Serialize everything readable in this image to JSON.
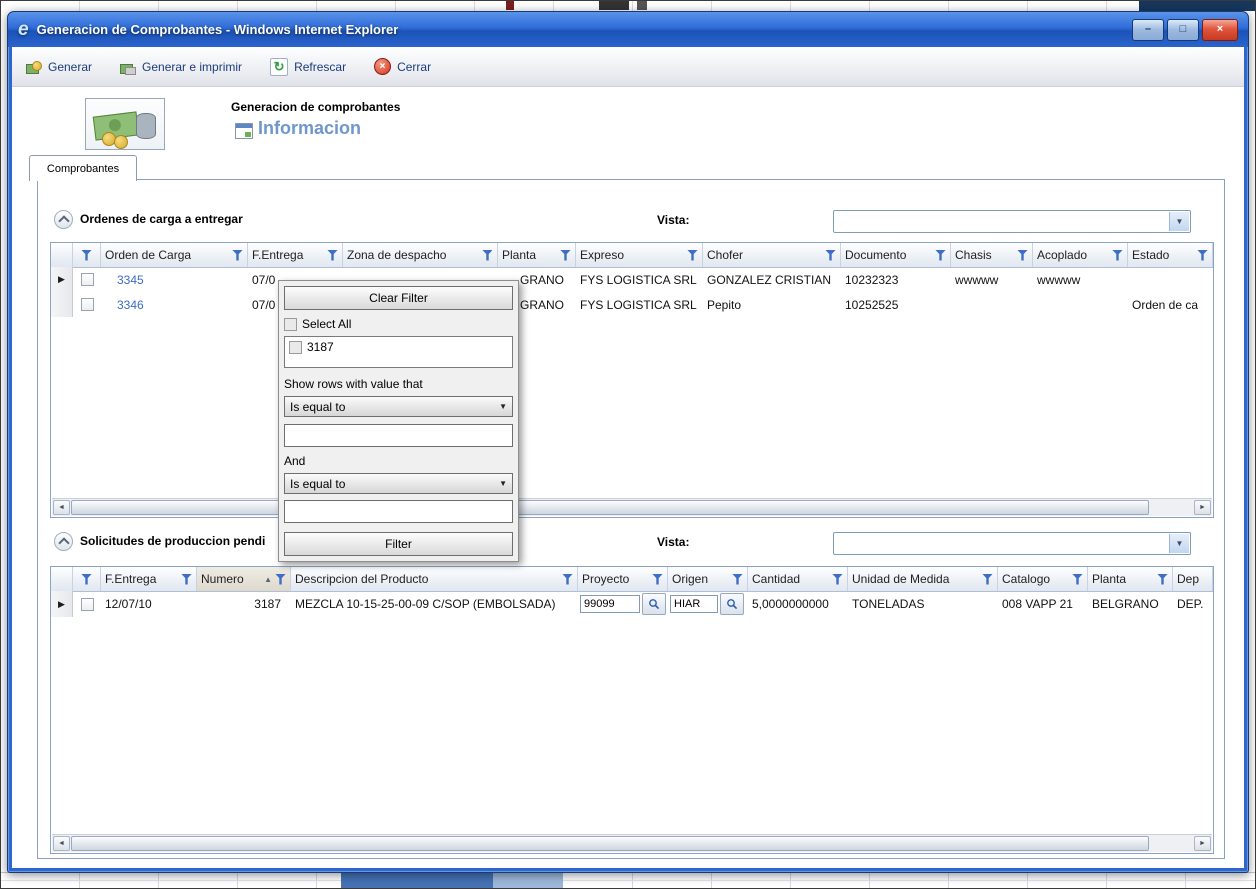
{
  "window": {
    "title": "Generacion de Comprobantes - Windows Internet Explorer"
  },
  "icons": {
    "ie_logo": "e",
    "minimize": "–",
    "maximize": "□",
    "close": "×",
    "refresh": "↻",
    "row_marker": "▶",
    "sort_asc": "▲",
    "dropdown_arrow": "▼",
    "scroll_left": "◄",
    "scroll_right": "►"
  },
  "colors": {
    "titlebar_blue": "#2e68cf",
    "funnel_blue": "#3f6fc4",
    "link_blue": "#3c6cc3",
    "subtitle_blue": "#6f96ce",
    "close_red": "#d6351c"
  },
  "toolbar": {
    "generar": "Generar",
    "generar_imprimir": "Generar e imprimir",
    "refrescar": "Refrescar",
    "cerrar": "Cerrar"
  },
  "page_header": {
    "title": "Generacion de comprobantes",
    "subtitle": "Informacion"
  },
  "tabs": {
    "comprobantes": "Comprobantes"
  },
  "ordenes": {
    "title": "Ordenes de carga a entregar",
    "vista_label": "Vista:",
    "vista_value": "",
    "columns": [
      "Orden de Carga",
      "F.Entrega",
      "Zona de despacho",
      "Planta",
      "Expreso",
      "Chofer",
      "Documento",
      "Chasis",
      "Acoplado",
      "Estado"
    ],
    "rows": [
      {
        "orden_de_carga": "3345",
        "f_entrega": "07/0",
        "zona_de_despacho": "",
        "planta": "GRANO",
        "expreso": "FYS LOGISTICA SRL",
        "chofer": "GONZALEZ CRISTIAN",
        "documento": "10232323",
        "chasis": "wwwww",
        "acoplado": "wwwww",
        "estado": ""
      },
      {
        "orden_de_carga": "3346",
        "f_entrega": "07/0",
        "zona_de_despacho": "",
        "planta": "GRANO",
        "expreso": "FYS LOGISTICA SRL",
        "chofer": "Pepito",
        "documento": "10252525",
        "chasis": "",
        "acoplado": "",
        "estado": "Orden de ca"
      }
    ]
  },
  "filter_popup": {
    "clear_filter": "Clear Filter",
    "select_all": "Select All",
    "options": [
      "3187"
    ],
    "show_rows_label": "Show rows with value that",
    "operator1": "Is equal to",
    "value1": "",
    "and_label": "And",
    "operator2": "Is equal to",
    "value2": "",
    "filter": "Filter"
  },
  "solicitudes": {
    "title": "Solicitudes de produccion pendi",
    "vista_label": "Vista:",
    "vista_value": "",
    "columns": [
      "F.Entrega",
      "Numero",
      "Descripcion del Producto",
      "Proyecto",
      "Origen",
      "Cantidad",
      "Unidad de Medida",
      "Catalogo",
      "Planta",
      "Dep"
    ],
    "rows": [
      {
        "f_entrega": "12/07/10",
        "numero": "3187",
        "descripcion": "MEZCLA 10-15-25-00-09 C/SOP (EMBOLSADA)",
        "proyecto": "99099",
        "origen": "HIAR",
        "cantidad": "5,0000000000",
        "unidad_de_medida": "TONELADAS",
        "catalogo": "008 VAPP 21",
        "planta": "BELGRANO",
        "dep": "DEP."
      }
    ]
  }
}
